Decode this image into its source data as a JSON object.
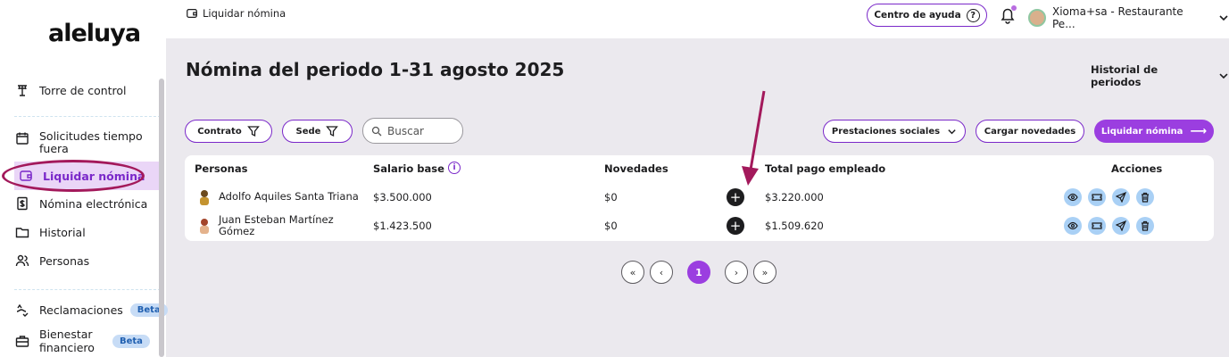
{
  "app": {
    "logo": "aleluya"
  },
  "sidebar": {
    "items": [
      {
        "label": "Torre de control",
        "icon": "control-tower-icon"
      },
      {
        "label": "Solicitudes tiempo fuera",
        "icon": "calendar-icon"
      },
      {
        "label": "Liquidar nómina",
        "icon": "wallet-icon",
        "active": true
      },
      {
        "label": "Nómina electrónica",
        "icon": "dollar-document-icon"
      },
      {
        "label": "Historial",
        "icon": "folder-icon"
      },
      {
        "label": "Personas",
        "icon": "people-icon"
      },
      {
        "label": "Reclamaciones",
        "icon": "claims-icon",
        "badge": "Beta"
      },
      {
        "label": "Bienestar financiero",
        "icon": "briefcase-icon",
        "badge": "Beta"
      }
    ]
  },
  "header": {
    "breadcrumb": "Liquidar nómina",
    "help_label": "Centro de ayuda",
    "user_name": "Xioma+sa - Restaurante Pe..."
  },
  "main": {
    "title": "Nómina del periodo 1-31 agosto 2025",
    "history_label": "Historial de periodos",
    "filters": {
      "contrato": "Contrato",
      "sede": "Sede"
    },
    "search": {
      "placeholder": "Buscar"
    },
    "actions": {
      "prestaciones": "Prestaciones sociales",
      "cargar": "Cargar novedades",
      "liquidar": "Liquidar nómina"
    },
    "table": {
      "headers": {
        "personas": "Personas",
        "salario": "Salario base",
        "novedades": "Novedades",
        "total": "Total pago empleado",
        "acciones": "Acciones"
      },
      "rows": [
        {
          "name": "Adolfo Aquiles Santa Triana",
          "salary": "$3.500.000",
          "novedades": "$0",
          "total": "$3.220.000"
        },
        {
          "name": "Juan Esteban Martínez Gómez",
          "salary": "$1.423.500",
          "novedades": "$0",
          "total": "$1.509.620"
        }
      ]
    },
    "pagination": {
      "current": "1"
    }
  },
  "colors": {
    "accent": "#9b3ee0",
    "annotation": "#a3195b"
  }
}
